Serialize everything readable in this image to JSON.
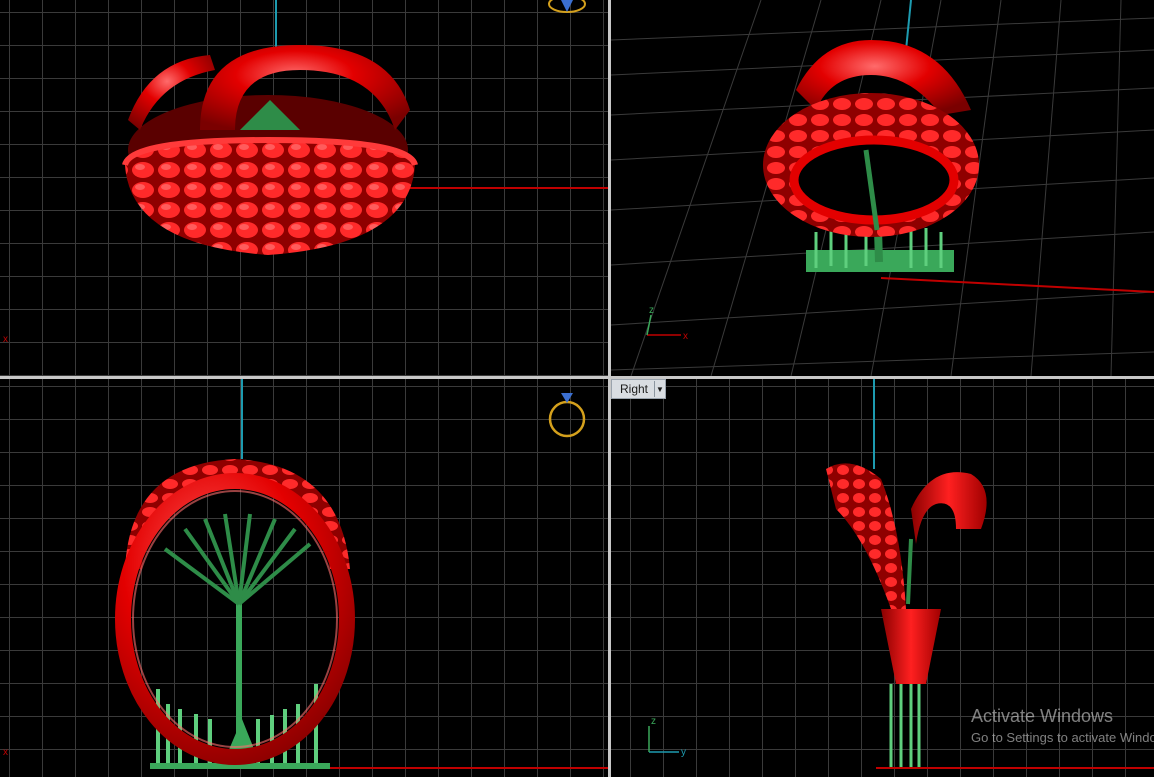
{
  "viewports": {
    "top": {
      "name": ""
    },
    "perspective": {
      "name": ""
    },
    "front": {
      "name": ""
    },
    "right": {
      "name": "Right",
      "dropdown_icon": "chevron-down-icon"
    }
  },
  "axes": {
    "x_letter": "x",
    "y_letter": "y",
    "z_letter": "z"
  },
  "watermark": {
    "title": "Activate Windows",
    "subtitle": "Go to Settings to activate Windows."
  },
  "colors": {
    "model": "#e00000",
    "supports": "#3aa85a",
    "x_axis": "#c00000",
    "y_axis": "#1d9bb0",
    "grid": "#3a3a3a",
    "background": "#000000",
    "gumball": "#d4a01c"
  }
}
